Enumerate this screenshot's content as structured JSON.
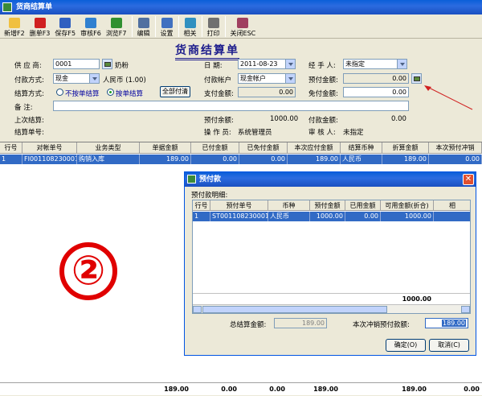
{
  "window": {
    "title": "货商结算单"
  },
  "toolbar": {
    "buttons": [
      {
        "label": "新增F2",
        "icon": "new-icon",
        "color": "#f0c040"
      },
      {
        "label": "删单F3",
        "icon": "delete-icon",
        "color": "#d02020"
      },
      {
        "label": "保存F5",
        "icon": "save-icon",
        "color": "#3060c0"
      },
      {
        "label": "审核F6",
        "icon": "audit-icon",
        "color": "#3080d0"
      },
      {
        "label": "浏览F7",
        "icon": "browse-icon",
        "color": "#309030"
      },
      {
        "label": "编辑",
        "icon": "edit-icon",
        "color": "#5070a0"
      },
      {
        "label": "设置",
        "icon": "settings-icon",
        "color": "#4070c0"
      },
      {
        "label": "相关",
        "icon": "related-icon",
        "color": "#3090c0"
      },
      {
        "label": "打印",
        "icon": "print-icon",
        "color": "#707070"
      },
      {
        "label": "关闭ESC",
        "icon": "close-door-icon",
        "color": "#a04060"
      }
    ]
  },
  "form": {
    "title": "货商结算单",
    "supplier_label": "供 应 商:",
    "supplier_code": "0001",
    "supplier_name": "奶粉",
    "date_label": "日    期:",
    "date_value": "2011-08-23",
    "handler_label": "经 手 人:",
    "handler_value": "未指定",
    "pay_method_label": "付款方式:",
    "pay_method_value": "现金",
    "currency_value": "人民币 (1.00)",
    "pay_account_label": "付款帐户",
    "pay_account_value": "现金帐户",
    "prepay_amount_label": "预付金额:",
    "prepay_amount_value": "0.00",
    "settle_method_label": "结算方式:",
    "settle_option_1": "不按单结算",
    "settle_option_2": "按单结算",
    "pay_all_button": "全部付清",
    "pay_amount_label": "支付金额:",
    "pay_amount_value": "0.00",
    "waive_amount_label": "免付金额:",
    "waive_amount_value": "0.00",
    "remark_label": "备    注:",
    "remark_value": "",
    "last_settle_label": "上次结算:",
    "prepay_balance_label": "预付余额:",
    "prepay_balance_value": "1000.00",
    "payable_label": "付款金额:",
    "payable_value": "0.00",
    "settle_no_label": "结算单号:",
    "operator_label": "操 作 员:",
    "operator_value": "系统管理员",
    "reviewer_label": "审 核 人:",
    "reviewer_value": "未指定"
  },
  "grid": {
    "headers": [
      "行号",
      "对帐单号",
      "业务类型",
      "单据金额",
      "已付金额",
      "已免付金额",
      "本次应付金额",
      "结算币种",
      "折算金额",
      "本次预付冲销"
    ],
    "row": [
      "1",
      "FI001108230001",
      "购销入库",
      "189.00",
      "0.00",
      "0.00",
      "189.00",
      "人民币",
      "189.00",
      "0.00"
    ],
    "footer": [
      "",
      "",
      "",
      "189.00",
      "0.00",
      "0.00",
      "189.00",
      "",
      "189.00",
      "0.00"
    ]
  },
  "overlay_mark": "②",
  "dialog": {
    "title": "预付款",
    "subtitle": "预付款明细:",
    "headers": [
      "行号",
      "预付单号",
      "币种",
      "预付金额",
      "已用金额",
      "可用金额(折合)",
      "相"
    ],
    "row": [
      "1",
      "ST001108230001",
      "人民币",
      "1000.00",
      "0.00",
      "1000.00",
      ""
    ],
    "footer_total": "1000.00",
    "total_settle_label": "总结算金额:",
    "total_settle_value": "189.00",
    "offset_label": "本次冲销预付款额:",
    "offset_value": "189.00",
    "ok_button": "确定(O)",
    "cancel_button": "取消(C)"
  }
}
